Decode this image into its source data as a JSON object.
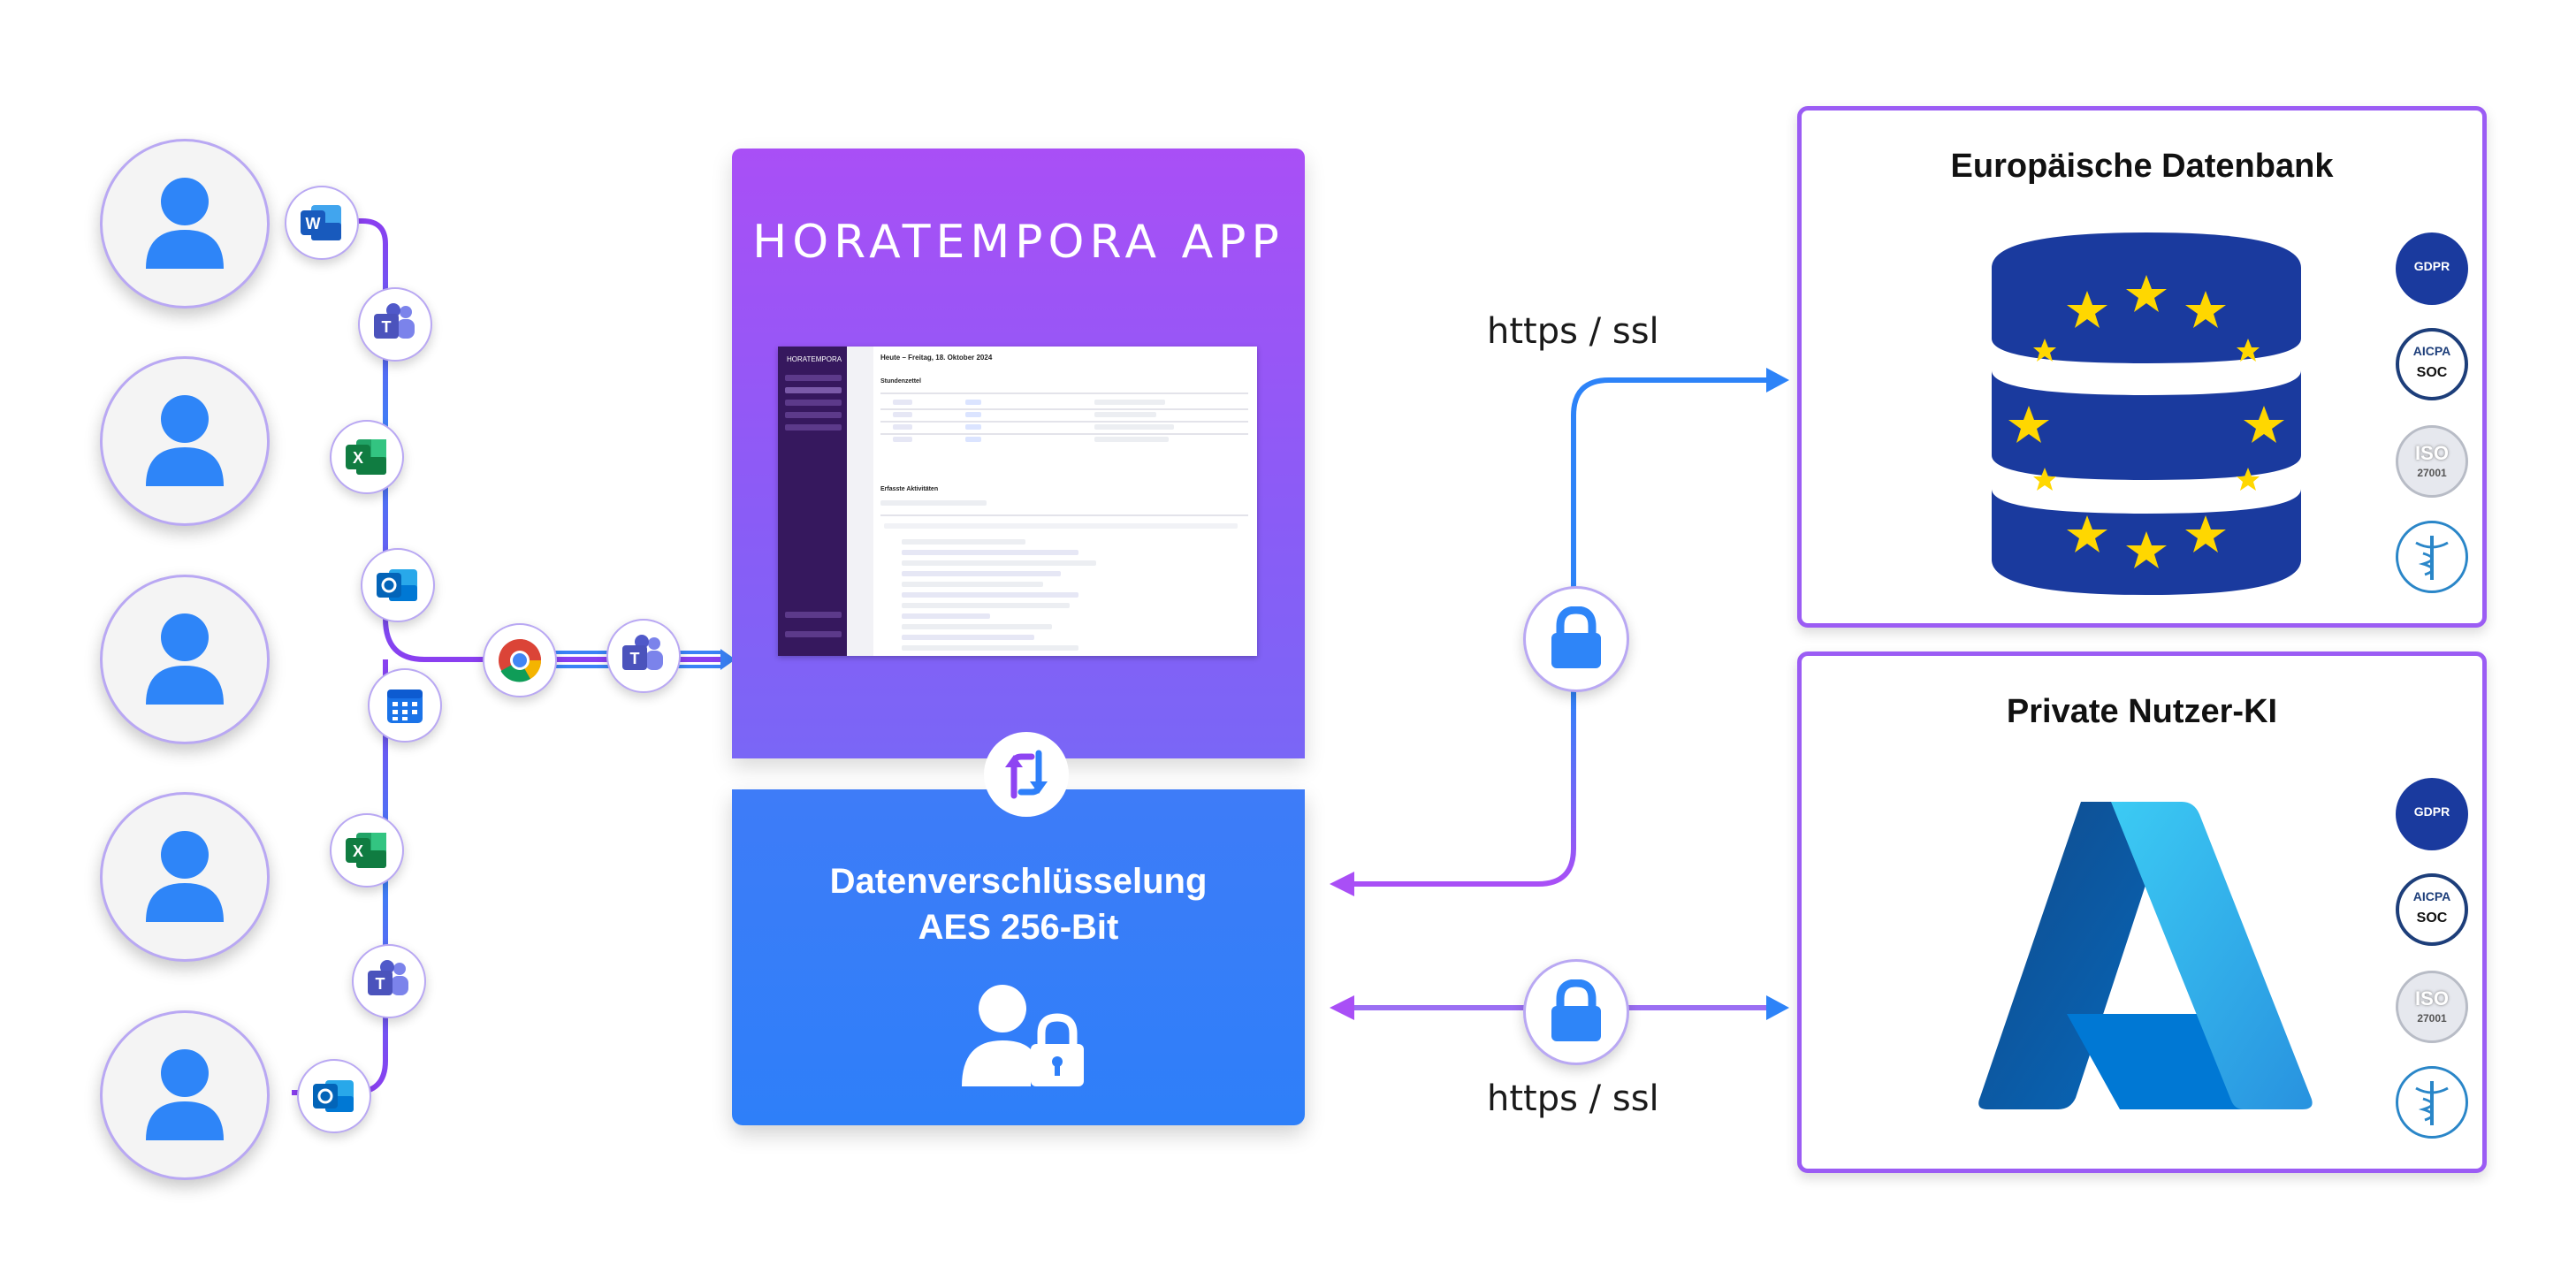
{
  "app": {
    "title": "HORATEMPORA APP"
  },
  "screenshot": {
    "brand": "HORATEMPORA",
    "heading": "Heute – Freitag, 18. Oktober 2024",
    "section1": "Stundenzettel",
    "section2": "Erfasste Aktivitäten"
  },
  "encryption": {
    "line1": "Datenverschlüsselung",
    "line2": "AES 256-Bit"
  },
  "connections": {
    "top_label": "https / ssl",
    "bottom_label": "https / ssl"
  },
  "database_card": {
    "title": "Europäische Datenbank"
  },
  "ai_card": {
    "title": "Private Nutzer-KI"
  },
  "badges": {
    "gdpr": "GDPR",
    "aicpa": "AICPA",
    "soc": "SOC",
    "iso": "ISO",
    "iso_num": "27001"
  },
  "icons": [
    "user-icon",
    "word-icon",
    "teams-icon",
    "excel-icon",
    "outlook-icon",
    "calendar-icon",
    "chrome-icon",
    "sync-icon",
    "lock-icon",
    "eu-database-icon",
    "azure-icon",
    "gdpr-badge",
    "aicpa-soc-badge",
    "iso-27001-badge",
    "hipaa-badge"
  ],
  "colors": {
    "purple": "#a94ff6",
    "blue": "#2e7ff9",
    "navy": "#1a3a9e",
    "star": "#ffd700"
  }
}
